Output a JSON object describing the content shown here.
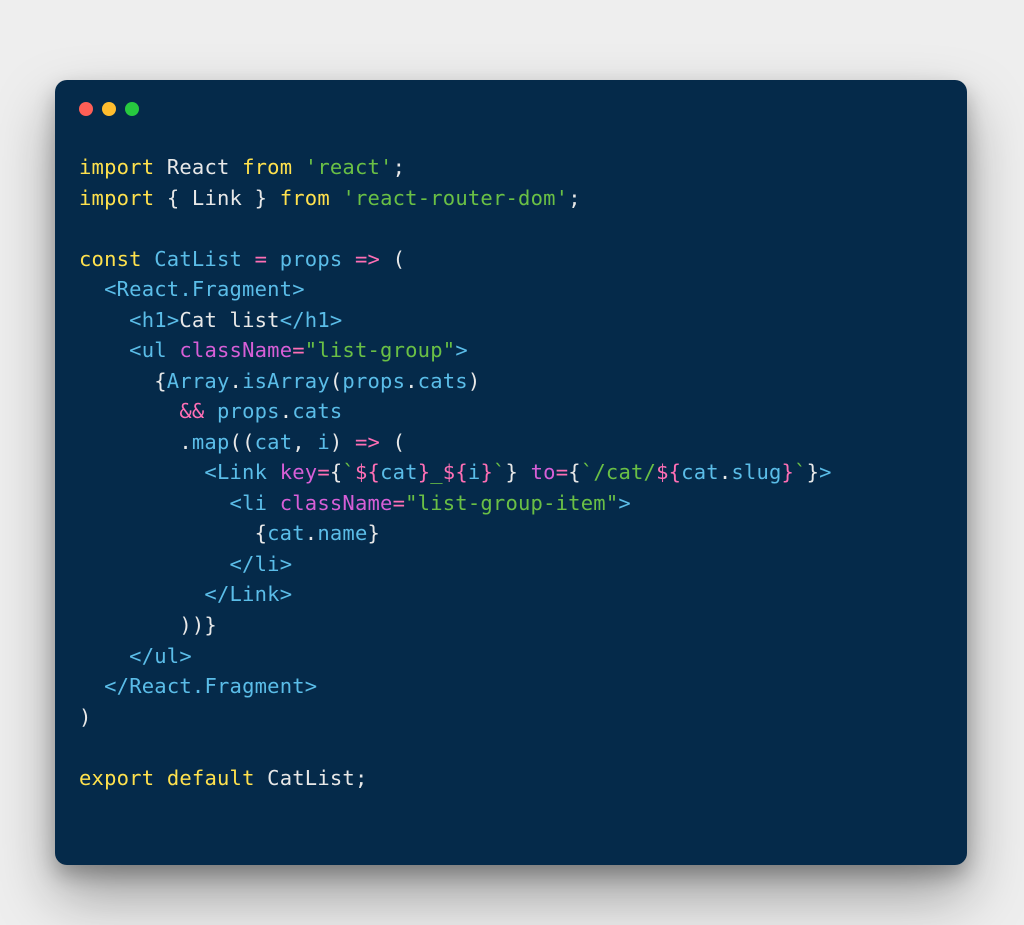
{
  "colors": {
    "bg": "#052a4a",
    "page": "#eeeeee",
    "red": "#ff5f56",
    "yellow": "#ffbd2e",
    "green": "#27c93f",
    "keyword": "#ffe14d",
    "plain": "#e8e8e8",
    "blue": "#5bbde8",
    "string": "#6ac045",
    "magenta_op": "#ff6fb5",
    "magenta_attr": "#d75fd7"
  },
  "code_plain": "import React from 'react';\nimport { Link } from 'react-router-dom';\n\nconst CatList = props => (\n  <React.Fragment>\n    <h1>Cat list</h1>\n    <ul className=\"list-group\">\n      {Array.isArray(props.cats)\n        && props.cats\n        .map((cat, i) => (\n          <Link key={`${cat}_${i}`} to={`/cat/${cat.slug}`}>\n            <li className=\"list-group-item\">\n              {cat.name}\n            </li>\n          </Link>\n        ))}\n    </ul>\n  </React.Fragment>\n)\n\nexport default CatList;",
  "code_lines_tokens": [
    [
      {
        "t": "import",
        "c": "kw"
      },
      {
        "t": " ",
        "c": "pun"
      },
      {
        "t": "React",
        "c": "def"
      },
      {
        "t": " ",
        "c": "pun"
      },
      {
        "t": "from",
        "c": "kw"
      },
      {
        "t": " ",
        "c": "pun"
      },
      {
        "t": "'react'",
        "c": "str"
      },
      {
        "t": ";",
        "c": "pun"
      }
    ],
    [
      {
        "t": "import",
        "c": "kw"
      },
      {
        "t": " ",
        "c": "pun"
      },
      {
        "t": "{ ",
        "c": "pun"
      },
      {
        "t": "Link",
        "c": "def"
      },
      {
        "t": " } ",
        "c": "pun"
      },
      {
        "t": "from",
        "c": "kw"
      },
      {
        "t": " ",
        "c": "pun"
      },
      {
        "t": "'react-router-dom'",
        "c": "str"
      },
      {
        "t": ";",
        "c": "pun"
      }
    ],
    [],
    [
      {
        "t": "const",
        "c": "kw"
      },
      {
        "t": " ",
        "c": "pun"
      },
      {
        "t": "CatList",
        "c": "fn"
      },
      {
        "t": " ",
        "c": "pun"
      },
      {
        "t": "=",
        "c": "op"
      },
      {
        "t": " ",
        "c": "pun"
      },
      {
        "t": "props",
        "c": "fn"
      },
      {
        "t": " ",
        "c": "pun"
      },
      {
        "t": "=>",
        "c": "op"
      },
      {
        "t": " (",
        "c": "pun"
      }
    ],
    [
      {
        "t": "  ",
        "c": "pun"
      },
      {
        "t": "<",
        "c": "brk"
      },
      {
        "t": "React.Fragment",
        "c": "tag"
      },
      {
        "t": ">",
        "c": "brk"
      }
    ],
    [
      {
        "t": "    ",
        "c": "pun"
      },
      {
        "t": "<",
        "c": "brk"
      },
      {
        "t": "h1",
        "c": "tag"
      },
      {
        "t": ">",
        "c": "brk"
      },
      {
        "t": "Cat list",
        "c": "def"
      },
      {
        "t": "</",
        "c": "brk"
      },
      {
        "t": "h1",
        "c": "tag"
      },
      {
        "t": ">",
        "c": "brk"
      }
    ],
    [
      {
        "t": "    ",
        "c": "pun"
      },
      {
        "t": "<",
        "c": "brk"
      },
      {
        "t": "ul",
        "c": "tag"
      },
      {
        "t": " ",
        "c": "pun"
      },
      {
        "t": "className",
        "c": "attr"
      },
      {
        "t": "=",
        "c": "op"
      },
      {
        "t": "\"list-group\"",
        "c": "str"
      },
      {
        "t": ">",
        "c": "brk"
      }
    ],
    [
      {
        "t": "      {",
        "c": "pun"
      },
      {
        "t": "Array",
        "c": "fn"
      },
      {
        "t": ".",
        "c": "pun"
      },
      {
        "t": "isArray",
        "c": "fn"
      },
      {
        "t": "(",
        "c": "pun"
      },
      {
        "t": "props",
        "c": "fn"
      },
      {
        "t": ".",
        "c": "pun"
      },
      {
        "t": "cats",
        "c": "fn"
      },
      {
        "t": ")",
        "c": "pun"
      }
    ],
    [
      {
        "t": "        ",
        "c": "pun"
      },
      {
        "t": "&&",
        "c": "op"
      },
      {
        "t": " ",
        "c": "pun"
      },
      {
        "t": "props",
        "c": "fn"
      },
      {
        "t": ".",
        "c": "pun"
      },
      {
        "t": "cats",
        "c": "fn"
      }
    ],
    [
      {
        "t": "        .",
        "c": "pun"
      },
      {
        "t": "map",
        "c": "fn"
      },
      {
        "t": "((",
        "c": "pun"
      },
      {
        "t": "cat",
        "c": "fn"
      },
      {
        "t": ", ",
        "c": "pun"
      },
      {
        "t": "i",
        "c": "fn"
      },
      {
        "t": ") ",
        "c": "pun"
      },
      {
        "t": "=>",
        "c": "op"
      },
      {
        "t": " (",
        "c": "pun"
      }
    ],
    [
      {
        "t": "          ",
        "c": "pun"
      },
      {
        "t": "<",
        "c": "brk"
      },
      {
        "t": "Link",
        "c": "tag"
      },
      {
        "t": " ",
        "c": "pun"
      },
      {
        "t": "key",
        "c": "attr"
      },
      {
        "t": "=",
        "c": "op"
      },
      {
        "t": "{",
        "c": "pun"
      },
      {
        "t": "`",
        "c": "tl"
      },
      {
        "t": "${",
        "c": "op"
      },
      {
        "t": "cat",
        "c": "ti"
      },
      {
        "t": "}",
        "c": "op"
      },
      {
        "t": "_",
        "c": "tl"
      },
      {
        "t": "${",
        "c": "op"
      },
      {
        "t": "i",
        "c": "ti"
      },
      {
        "t": "}",
        "c": "op"
      },
      {
        "t": "`",
        "c": "tl"
      },
      {
        "t": "}",
        "c": "pun"
      },
      {
        "t": " ",
        "c": "pun"
      },
      {
        "t": "to",
        "c": "attr"
      },
      {
        "t": "=",
        "c": "op"
      },
      {
        "t": "{",
        "c": "pun"
      },
      {
        "t": "`",
        "c": "tl"
      },
      {
        "t": "/cat/",
        "c": "tl"
      },
      {
        "t": "${",
        "c": "op"
      },
      {
        "t": "cat",
        "c": "ti"
      },
      {
        "t": ".",
        "c": "pun"
      },
      {
        "t": "slug",
        "c": "ti"
      },
      {
        "t": "}",
        "c": "op"
      },
      {
        "t": "`",
        "c": "tl"
      },
      {
        "t": "}",
        "c": "pun"
      },
      {
        "t": ">",
        "c": "brk"
      }
    ],
    [
      {
        "t": "            ",
        "c": "pun"
      },
      {
        "t": "<",
        "c": "brk"
      },
      {
        "t": "li",
        "c": "tag"
      },
      {
        "t": " ",
        "c": "pun"
      },
      {
        "t": "className",
        "c": "attr"
      },
      {
        "t": "=",
        "c": "op"
      },
      {
        "t": "\"list-group-item\"",
        "c": "str"
      },
      {
        "t": ">",
        "c": "brk"
      }
    ],
    [
      {
        "t": "              {",
        "c": "pun"
      },
      {
        "t": "cat",
        "c": "fn"
      },
      {
        "t": ".",
        "c": "pun"
      },
      {
        "t": "name",
        "c": "fn"
      },
      {
        "t": "}",
        "c": "pun"
      }
    ],
    [
      {
        "t": "            ",
        "c": "pun"
      },
      {
        "t": "</",
        "c": "brk"
      },
      {
        "t": "li",
        "c": "tag"
      },
      {
        "t": ">",
        "c": "brk"
      }
    ],
    [
      {
        "t": "          ",
        "c": "pun"
      },
      {
        "t": "</",
        "c": "brk"
      },
      {
        "t": "Link",
        "c": "tag"
      },
      {
        "t": ">",
        "c": "brk"
      }
    ],
    [
      {
        "t": "        ))}",
        "c": "pun"
      }
    ],
    [
      {
        "t": "    ",
        "c": "pun"
      },
      {
        "t": "</",
        "c": "brk"
      },
      {
        "t": "ul",
        "c": "tag"
      },
      {
        "t": ">",
        "c": "brk"
      }
    ],
    [
      {
        "t": "  ",
        "c": "pun"
      },
      {
        "t": "</",
        "c": "brk"
      },
      {
        "t": "React.Fragment",
        "c": "tag"
      },
      {
        "t": ">",
        "c": "brk"
      }
    ],
    [
      {
        "t": ")",
        "c": "pun"
      }
    ],
    [],
    [
      {
        "t": "export",
        "c": "kw"
      },
      {
        "t": " ",
        "c": "pun"
      },
      {
        "t": "default",
        "c": "kw"
      },
      {
        "t": " ",
        "c": "pun"
      },
      {
        "t": "CatList",
        "c": "def"
      },
      {
        "t": ";",
        "c": "pun"
      }
    ]
  ]
}
